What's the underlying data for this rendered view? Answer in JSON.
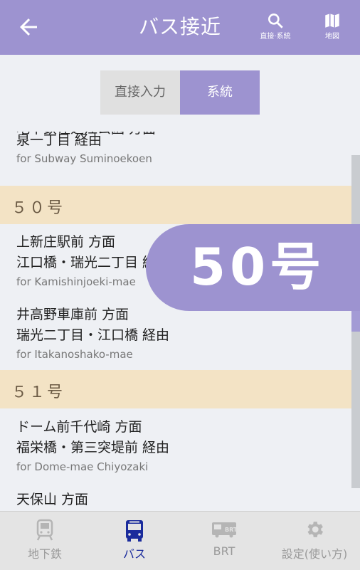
{
  "header": {
    "title": "バス接近",
    "search_label": "直接·系統",
    "map_label": "地図"
  },
  "segment": {
    "direct": "直接入力",
    "route": "系統"
  },
  "items": [
    {
      "l1": "地下鉄住之江公園 方面",
      "l2": "泉一丁目 経由",
      "en": "for Subway Suminoekoen"
    },
    {
      "l1": "上新庄駅前 方面",
      "l2": "江口橋・瑞光二丁目 経由",
      "en": "for Kamishinjoeki-mae"
    },
    {
      "l1": "井高野車庫前 方面",
      "l2": "瑞光二丁目・江口橋 経由",
      "en": "for Itakanoshako-mae"
    },
    {
      "l1": "ドーム前千代崎 方面",
      "l2": "福栄橋・第三突堤前 経由",
      "en": "for Dome-mae Chiyozaki"
    },
    {
      "l1": "天保山 方面"
    }
  ],
  "groups": [
    "５０号",
    "５１号"
  ],
  "bubble": "50号",
  "tabs": {
    "subway": "地下鉄",
    "bus": "バス",
    "brt": "BRT",
    "settings": "設定(使い方)"
  }
}
